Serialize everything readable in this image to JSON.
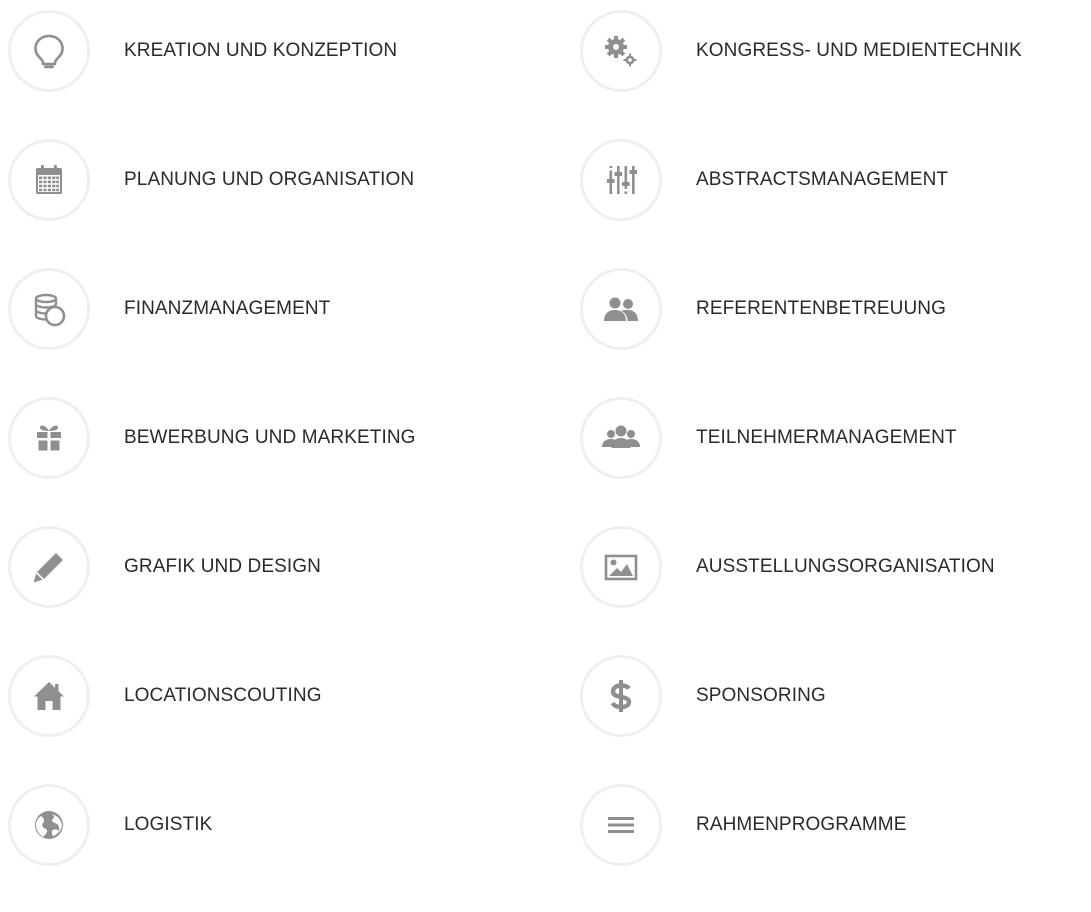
{
  "services": {
    "left": [
      {
        "label": "KREATION UND KONZEPTION",
        "icon": "lightbulb-icon"
      },
      {
        "label": "PLANUNG UND ORGANISATION",
        "icon": "calendar-icon"
      },
      {
        "label": "FINANZMANAGEMENT",
        "icon": "coins-icon"
      },
      {
        "label": "BEWERBUNG UND MARKETING",
        "icon": "gift-icon"
      },
      {
        "label": "GRAFIK UND DESIGN",
        "icon": "pencil-icon"
      },
      {
        "label": "LOCATIONSCOUTING",
        "icon": "home-icon"
      },
      {
        "label": "LOGISTIK",
        "icon": "globe-icon"
      }
    ],
    "right": [
      {
        "label": "KONGRESS- UND MEDIENTECHNIK",
        "icon": "gears-icon"
      },
      {
        "label": "ABSTRACTSMANAGEMENT",
        "icon": "sliders-icon"
      },
      {
        "label": "REFERENTENBETREUUNG",
        "icon": "users-icon"
      },
      {
        "label": "TEILNEHMERMANAGEMENT",
        "icon": "group-icon"
      },
      {
        "label": "AUSSTELLUNGSORGANISATION",
        "icon": "picture-icon"
      },
      {
        "label": "SPONSORING",
        "icon": "dollar-icon"
      },
      {
        "label": "RAHMENPROGRAMME",
        "icon": "menu-lines-icon"
      }
    ]
  },
  "colors": {
    "icon": "#8f8f8f",
    "circle_border": "#efefef",
    "text": "#2a2a2a"
  }
}
